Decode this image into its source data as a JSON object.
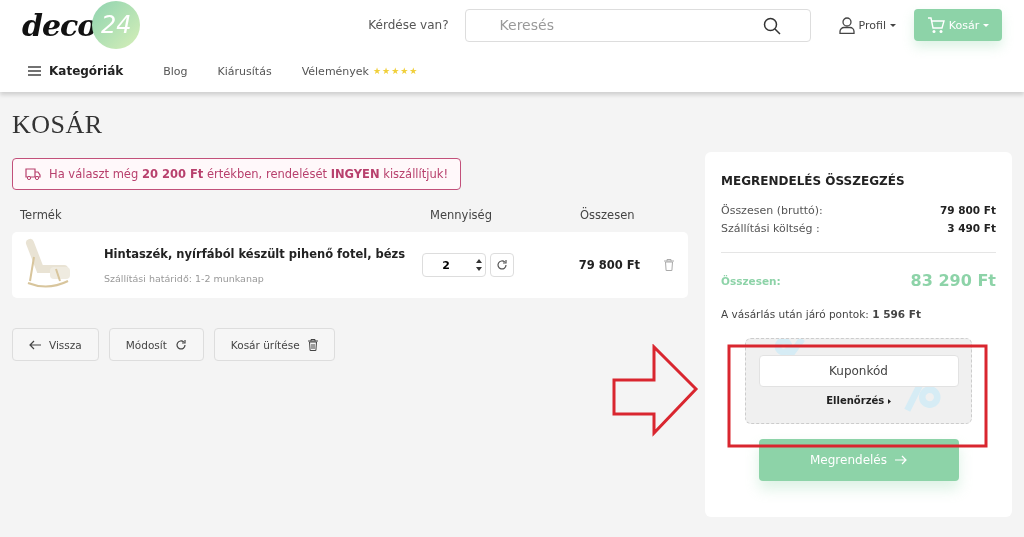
{
  "header": {
    "logo": {
      "word": "deco",
      "number": "24"
    },
    "question": "Kérdése van?",
    "search": {
      "placeholder": "Keresés"
    },
    "profile": "Profil",
    "cart_button": "Kosár"
  },
  "nav": {
    "categories": "Kategóriák",
    "links": [
      "Blog",
      "Kiárusítás"
    ],
    "reviews": {
      "label": "Vélemények",
      "stars": 5
    }
  },
  "page_title": "KOSÁR",
  "notice": "Ha választ még **20 200 Ft** értékben, rendelését **INGYEN** kiszállítjuk!",
  "table": {
    "columns": [
      "Termék",
      "Mennyiség",
      "Összesen"
    ],
    "rows": [
      {
        "name": "Hintaszék, nyírfából készült pihenő fotel, bézs",
        "delivery": "Szállítási határidő: 1-2 munkanap",
        "quantity": "2",
        "total": "79 800 Ft"
      }
    ]
  },
  "actions": [
    {
      "kind": "back",
      "label": "Vissza"
    },
    {
      "kind": "update",
      "label": "Módosít"
    },
    {
      "kind": "empty",
      "label": "Kosár ürítése"
    }
  ],
  "summary": {
    "title": "MEGRENDELÉS ÖSSZEGZÉS",
    "lines": [
      {
        "label": "Összesen (bruttó):",
        "value": "79 800 Ft"
      },
      {
        "label": "Szállítási költség :",
        "value": "3 490 Ft"
      }
    ],
    "total_label": "Összesen:",
    "total_value": "83 290 Ft",
    "points": "A vásárlás után járó pontok: **1 596 Ft**",
    "coupon": {
      "placeholder": "Kuponkód",
      "check": "Ellenőrzés"
    },
    "order_button": "Megrendelés"
  }
}
